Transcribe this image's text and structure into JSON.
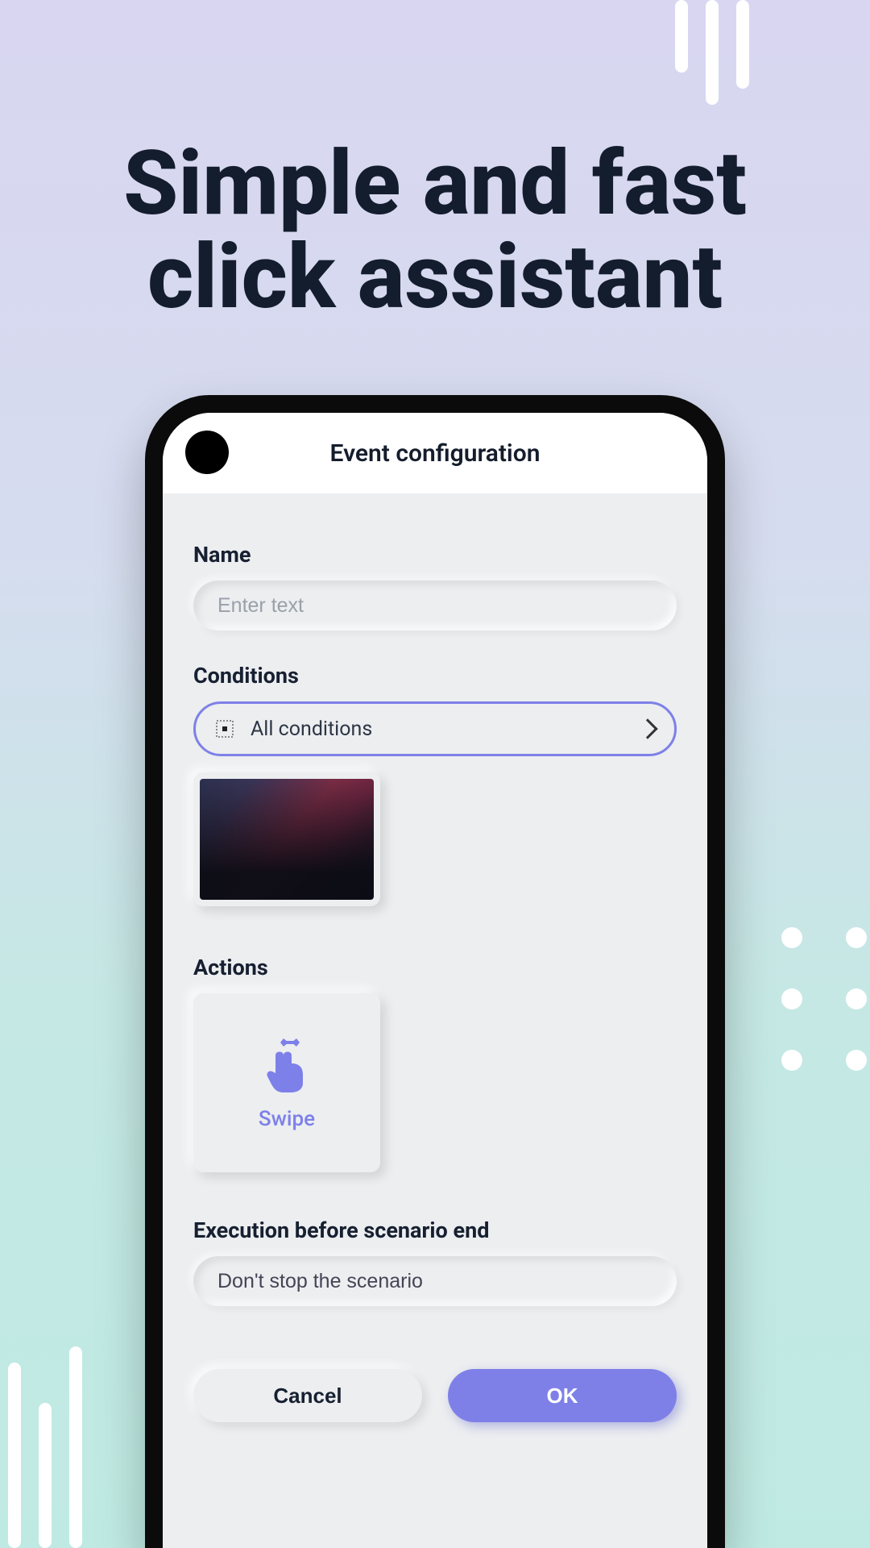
{
  "promo": {
    "headline": "Simple and fast click assistant"
  },
  "app": {
    "header_title": "Event configuration",
    "name_label": "Name",
    "name_placeholder": "Enter text",
    "conditions_label": "Conditions",
    "conditions_value": "All conditions",
    "actions_label": "Actions",
    "action_swipe": "Swipe",
    "execution_label": "Execution before scenario end",
    "execution_value": "Don't stop the scenario",
    "cancel": "Cancel",
    "ok": "OK"
  },
  "colors": {
    "accent": "#7e80e8",
    "text_dark": "#141d2e"
  }
}
